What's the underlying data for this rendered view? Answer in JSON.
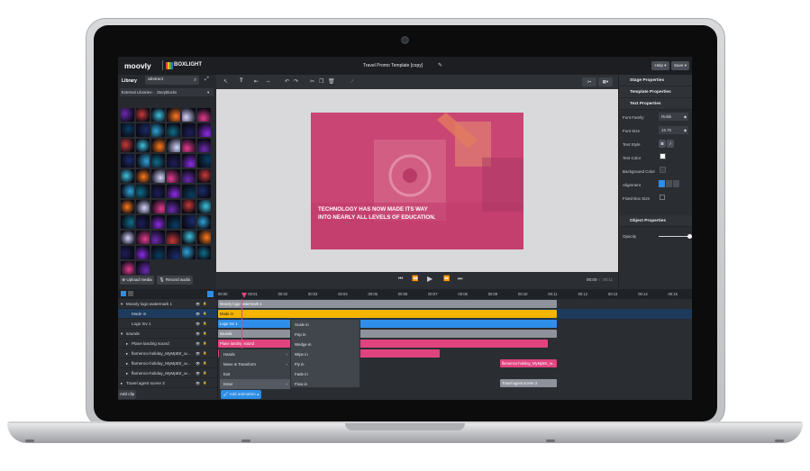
{
  "app": {
    "logo": "moovly",
    "partner": "BOXLIGHT",
    "project_title": "Travel Promo Template [copy]"
  },
  "topbar": {
    "help_label": "Help",
    "save_label": "Save"
  },
  "library": {
    "title": "Library",
    "search_value": "abstract",
    "filter_label": "External Libraries",
    "filter_value": "Storyblocks",
    "upload_label": "Upload media",
    "record_label": "Record audio"
  },
  "canvas": {
    "headline_line1": "TECHNOLOGY HAS NOW MADE ITS WAY",
    "headline_line2": "INTO NEARLY ALL LEVELS OF EDUCATION."
  },
  "player": {
    "current_time": "00:00",
    "total_time": "00:11"
  },
  "timeline": {
    "ticks": [
      "00:00",
      "00:01",
      "00:02",
      "00:03",
      "00:04",
      "00:05",
      "00:06",
      "00:07",
      "00:08",
      "00:09",
      "00:10",
      "00:11",
      "00:12",
      "00:13",
      "00:14",
      "00:15"
    ],
    "add_clip_label": "Add clip",
    "add_animation_label": "Add animation"
  },
  "layers": [
    {
      "name": "Moovly logo watermark 1",
      "clip": "Moovly logo watermark 1"
    },
    {
      "name": "Made in",
      "clip": "Made in"
    },
    {
      "name": "Logo Inv 1",
      "clip": "Logo Inv 1"
    },
    {
      "name": "sounds",
      "clip": "sounds"
    },
    {
      "name": "Plane landing sound",
      "clip": "Plane landing sound"
    },
    {
      "name": "flamenco-holiday_MyMpEtr_w...",
      "clip": ""
    },
    {
      "name": "flamenco-holiday_MyMpEtr_w...",
      "clip": "flamenco-holiday_MyMpEtr_w..."
    },
    {
      "name": "flamenco-holiday_MyMpEtr_w...",
      "clip": ""
    },
    {
      "name": "Travel agent scene 3",
      "clip": "Travel agent scene 3"
    }
  ],
  "context_menu": {
    "items": [
      "Hands",
      "Move & Transform",
      "Exit",
      "Enter"
    ]
  },
  "submenu": {
    "items": [
      "Scale in",
      "Pop in",
      "Wedge in",
      "Wipe in",
      "Fly in",
      "Fade in",
      "Flow in"
    ]
  },
  "properties": {
    "sections": [
      "Stage Properties",
      "Template Properties",
      "Text Properties",
      "Object Properties"
    ],
    "font_family_label": "Font Family",
    "font_family_value": "Rubik",
    "font_size_label": "Font Size",
    "font_size_value": "15.76",
    "text_style_label": "Text Style",
    "bold_label": "B",
    "italic_label": "I",
    "text_color_label": "Text Color",
    "bg_color_label": "Background Color",
    "alignment_label": "Alignment",
    "fixed_box_label": "Fixed Box Size",
    "opacity_label": "Opacity",
    "opacity_value": 1.0
  },
  "colors": {
    "accent": "#2c8ee6",
    "pink": "#e0447f",
    "yellow": "#f5b400",
    "blue_clip": "#2f8ee8",
    "grey_clip": "#8e939b",
    "canvas_bg": "#d9d9dc"
  }
}
